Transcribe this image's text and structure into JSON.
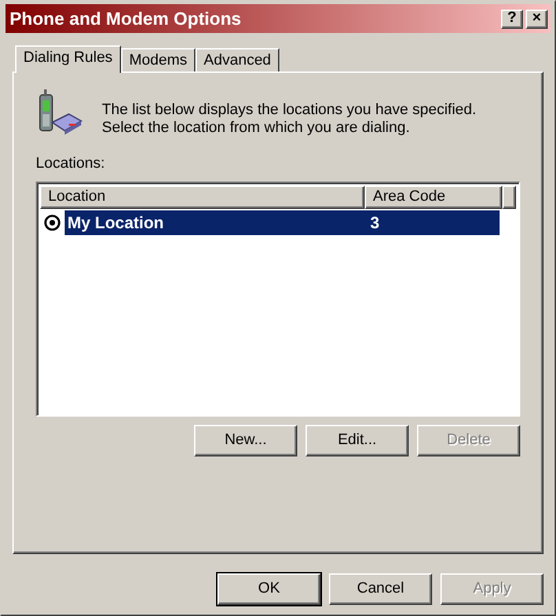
{
  "window": {
    "title": "Phone and Modem Options",
    "title_buttons": [
      "?",
      "×"
    ]
  },
  "tabs": [
    {
      "label": "Dialing Rules",
      "selected": true
    },
    {
      "label": "Modems",
      "selected": false
    },
    {
      "label": "Advanced",
      "selected": false
    }
  ],
  "description": "The list below displays the locations you have specified. Select the location from which you are dialing.",
  "locations": {
    "label": "Locations:",
    "columns": [
      "Location",
      "Area Code"
    ],
    "rows": [
      {
        "location": "My Location",
        "area_code": "3",
        "selected": true,
        "current": true
      }
    ]
  },
  "list_buttons": [
    {
      "label": "New...",
      "disabled": false
    },
    {
      "label": "Edit...",
      "disabled": false
    },
    {
      "label": "Delete",
      "disabled": true
    }
  ],
  "dialog_buttons": [
    {
      "label": "OK",
      "disabled": false,
      "default": true
    },
    {
      "label": "Cancel",
      "disabled": false,
      "default": false
    },
    {
      "label": "Apply",
      "disabled": true,
      "default": false
    }
  ]
}
